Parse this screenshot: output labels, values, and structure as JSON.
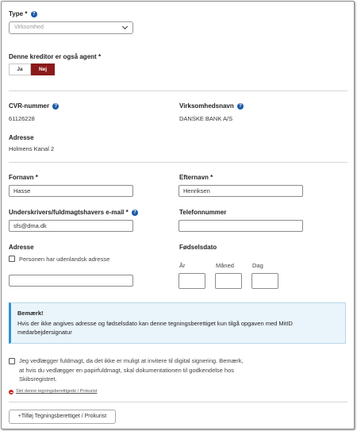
{
  "type_field": {
    "label": "Type",
    "required_mark": "*",
    "selected": "Virksomhed"
  },
  "agent_field": {
    "label": "Denne kreditor er også agent",
    "required_mark": "*",
    "options": [
      "Ja",
      "Nej"
    ],
    "selected": "Nej"
  },
  "company": {
    "cvr_label": "CVR-nummer",
    "cvr_value": "61126228",
    "name_label": "Virksomhedsnavn",
    "name_value": "DANSKE BANK A/S",
    "address_label": "Adresse",
    "address_value": "Holmens Kanal 2"
  },
  "signatory": {
    "first_name_label": "Fornavn",
    "first_name_value": "Hasse",
    "last_name_label": "Efternavn",
    "last_name_value": "Henriksen",
    "email_label": "Underskrivers/fuldmagtshavers e-mail",
    "email_value": "sfs@dma.dk",
    "phone_label": "Telefonnummer",
    "phone_value": "",
    "address_label": "Adresse",
    "foreign_address_label": "Personen har udenlandsk adresse",
    "address_value": "",
    "birthdate_label": "Fødselsdato",
    "year_label": "År",
    "month_label": "Måned",
    "day_label": "Dag",
    "required_mark": "*"
  },
  "note": {
    "title": "Bemærk!",
    "text": "Hvis der ikke angives adresse og fødselsdato kan denne tegningsberettiget kun tilgå opgaven med MitID medarbejdersignatur"
  },
  "power_of_attorney": {
    "text": "Jeg vedlægger fuldmagt, da det ikke er muligt at invitere til digital signering. Bemærk, at hvis du vedlægger en papirfuldmagt, skal dokumentationen til godkendelse hos Skibsregistret."
  },
  "remove_link": "Slet denne tegningsberettigede / Prokurist",
  "add_button": "+Tilføj Tegningsberettiget / Prokurist",
  "colors": {
    "selected_toggle": "#8b1a1a",
    "help_icon": "#1a5aa6",
    "note_border": "#2e95d3",
    "remove_icon": "#c62828"
  }
}
